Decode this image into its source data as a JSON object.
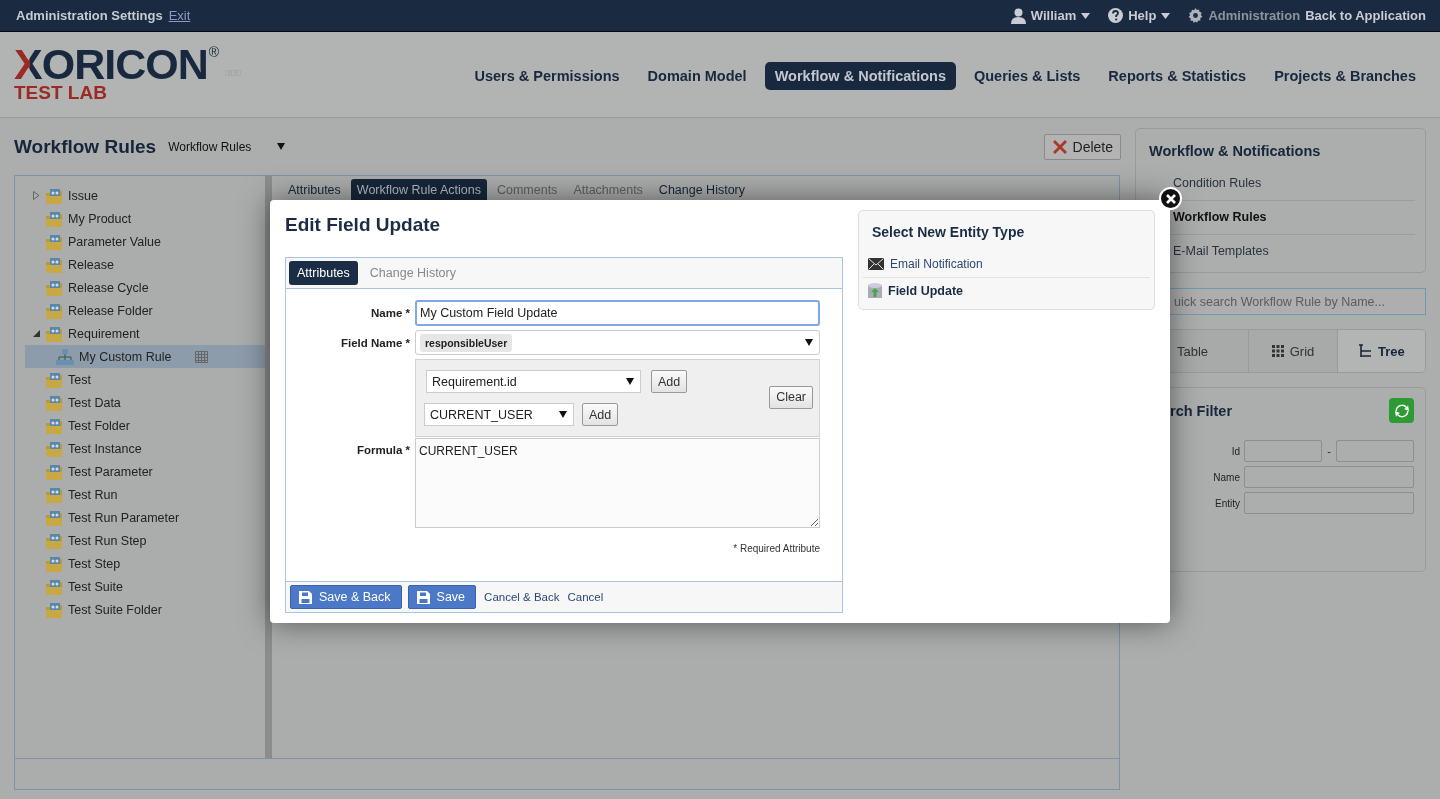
{
  "top_bar": {
    "title": "Administration Settings",
    "exit_link": "Exit",
    "user_menu": "William",
    "help_menu": "Help",
    "administration": "Administration",
    "back_link": "Back to Application"
  },
  "logo": {
    "name": "XORICON",
    "registered": "®",
    "subtitle": "TEST LAB"
  },
  "nav": [
    {
      "label": "Users & Permissions",
      "selected": false
    },
    {
      "label": "Domain Model",
      "selected": false
    },
    {
      "label": "Workflow & Notifications",
      "selected": true
    },
    {
      "label": "Queries & Lists",
      "selected": false
    },
    {
      "label": "Reports & Statistics",
      "selected": false
    },
    {
      "label": "Projects & Branches",
      "selected": false
    }
  ],
  "page": {
    "title": "Workflow Rules",
    "view_select": "Workflow Rules",
    "delete_button": "Delete"
  },
  "tree": [
    {
      "label": "Issue",
      "kind": "collapsed",
      "selected": false
    },
    {
      "label": "My Product",
      "kind": "leaf",
      "selected": false
    },
    {
      "label": "Parameter Value",
      "kind": "leaf",
      "selected": false
    },
    {
      "label": "Release",
      "kind": "leaf",
      "selected": false
    },
    {
      "label": "Release Cycle",
      "kind": "leaf",
      "selected": false
    },
    {
      "label": "Release Folder",
      "kind": "leaf",
      "selected": false
    },
    {
      "label": "Requirement",
      "kind": "expanded",
      "selected": false,
      "children": [
        {
          "label": "My Custom Rule",
          "kind": "rule",
          "selected": true
        }
      ]
    },
    {
      "label": "Test",
      "kind": "leaf",
      "selected": false
    },
    {
      "label": "Test Data",
      "kind": "leaf",
      "selected": false
    },
    {
      "label": "Test Folder",
      "kind": "leaf",
      "selected": false
    },
    {
      "label": "Test Instance",
      "kind": "leaf",
      "selected": false
    },
    {
      "label": "Test Parameter",
      "kind": "leaf",
      "selected": false
    },
    {
      "label": "Test Run",
      "kind": "leaf",
      "selected": false
    },
    {
      "label": "Test Run Parameter",
      "kind": "leaf",
      "selected": false
    },
    {
      "label": "Test Run Step",
      "kind": "leaf",
      "selected": false
    },
    {
      "label": "Test Step",
      "kind": "leaf",
      "selected": false
    },
    {
      "label": "Test Suite",
      "kind": "leaf",
      "selected": false
    },
    {
      "label": "Test Suite Folder",
      "kind": "leaf",
      "selected": false
    }
  ],
  "detail_tabs": [
    {
      "label": "Attributes",
      "selected": false,
      "disabled": false
    },
    {
      "label": "Workflow Rule Actions",
      "selected": true,
      "disabled": false
    },
    {
      "label": "Comments",
      "selected": false,
      "disabled": true
    },
    {
      "label": "Attachments",
      "selected": false,
      "disabled": true
    },
    {
      "label": "Change History",
      "selected": false,
      "disabled": false
    }
  ],
  "sidebar": {
    "title": "Workflow & Notifications",
    "links": [
      {
        "label": "Condition Rules",
        "selected": false
      },
      {
        "label": "Workflow Rules",
        "selected": true
      },
      {
        "label": "E-Mail Templates",
        "selected": false
      }
    ],
    "search": {
      "placeholder": "uick search Workflow Rule by Name..."
    },
    "views": [
      {
        "label": "Table",
        "selected": false
      },
      {
        "label": "Grid",
        "selected": false
      },
      {
        "label": "Tree",
        "selected": true
      }
    ],
    "filter": {
      "title": "rch Filter",
      "separator": "-",
      "fields": [
        {
          "label": "Id",
          "kind": "range"
        },
        {
          "label": "Name",
          "kind": "text"
        },
        {
          "label": "Entity",
          "kind": "text"
        }
      ]
    }
  },
  "modal": {
    "title": "Edit Field Update",
    "tabs": [
      {
        "label": "Attributes",
        "selected": true
      },
      {
        "label": "Change History",
        "selected": false
      }
    ],
    "form": {
      "name": {
        "label": "Name *",
        "value": "My Custom Field Update"
      },
      "field_name": {
        "label": "Field Name *",
        "value": "responsibleUser"
      },
      "formula": {
        "label": "Formula *",
        "attribute_select": "Requirement.id",
        "attribute_add": "Add",
        "variable_select": "CURRENT_USER",
        "variable_add": "Add",
        "clear": "Clear",
        "value": "CURRENT_USER"
      },
      "required_note": "* Required Attribute"
    },
    "buttons": [
      {
        "label": "Save & Back",
        "kind": "primary"
      },
      {
        "label": "Save",
        "kind": "primary"
      },
      {
        "label": "Cancel & Back",
        "kind": "link"
      },
      {
        "label": "Cancel",
        "kind": "link"
      }
    ],
    "entity_types": {
      "title": "Select New Entity Type",
      "items": [
        {
          "label": "Email Notification",
          "kind": "email",
          "selected": false
        },
        {
          "label": "Field Update",
          "kind": "field",
          "selected": true
        }
      ]
    }
  }
}
